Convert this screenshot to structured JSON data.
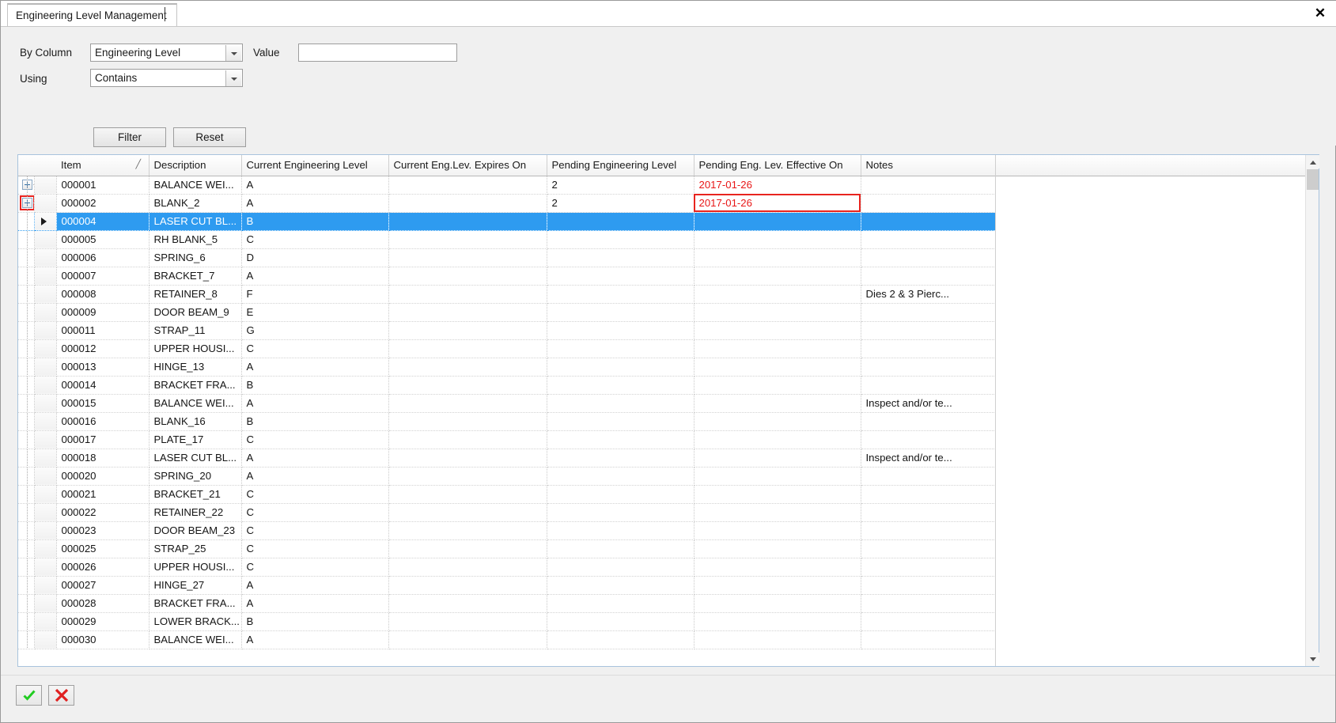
{
  "window": {
    "tab_title": "Engineering Level Management",
    "close_icon": "close-icon",
    "close_glyph": "✕"
  },
  "filter": {
    "by_column_label": "By Column",
    "by_column_value": "Engineering Level",
    "using_label": "Using",
    "using_value": "Contains",
    "value_label": "Value",
    "value_text": "",
    "value_placeholder": "",
    "filter_button": "Filter",
    "reset_button": "Reset"
  },
  "grid": {
    "columns": [
      {
        "key": "item",
        "label": "Item",
        "sorted": "asc",
        "sort_glyph": "╱"
      },
      {
        "key": "description",
        "label": "Description"
      },
      {
        "key": "current_level",
        "label": "Current Engineering Level"
      },
      {
        "key": "current_expires",
        "label": "Current Eng.Lev. Expires On"
      },
      {
        "key": "pending_level",
        "label": "Pending Engineering Level"
      },
      {
        "key": "pending_effective",
        "label": "Pending Eng. Lev. Effective On"
      },
      {
        "key": "notes",
        "label": "Notes"
      }
    ],
    "rows": [
      {
        "expander": true,
        "item": "000001",
        "description": "BALANCE  WEI...",
        "current_level": "A",
        "current_expires": "",
        "pending_level": "2",
        "pending_effective": "2017-01-26",
        "pending_effective_red": true,
        "notes": ""
      },
      {
        "expander": true,
        "expander_focused": true,
        "item": "000002",
        "description": "BLANK_2",
        "current_level": "A",
        "current_expires": "",
        "pending_level": "2",
        "pending_effective": "2017-01-26",
        "pending_effective_red": true,
        "pending_effective_focus": true,
        "notes": ""
      },
      {
        "selected": true,
        "item": "000004",
        "description": "LASER  CUT  BL...",
        "current_level": "B",
        "current_expires": "",
        "pending_level": "",
        "pending_effective": "",
        "notes": ""
      },
      {
        "item": "000005",
        "description": "RH BLANK_5",
        "current_level": "C",
        "current_expires": "",
        "pending_level": "",
        "pending_effective": "",
        "notes": ""
      },
      {
        "item": "000006",
        "description": "SPRING_6",
        "current_level": "D",
        "current_expires": "",
        "pending_level": "",
        "pending_effective": "",
        "notes": ""
      },
      {
        "item": "000007",
        "description": "BRACKET_7",
        "current_level": "A",
        "current_expires": "",
        "pending_level": "",
        "pending_effective": "",
        "notes": ""
      },
      {
        "item": "000008",
        "description": "RETAINER_8",
        "current_level": "F",
        "current_expires": "",
        "pending_level": "",
        "pending_effective": "",
        "notes": "Dies 2 & 3 Pierc..."
      },
      {
        "item": "000009",
        "description": "DOOR BEAM_9",
        "current_level": "E",
        "current_expires": "",
        "pending_level": "",
        "pending_effective": "",
        "notes": ""
      },
      {
        "item": "000011",
        "description": "STRAP_11",
        "current_level": "G",
        "current_expires": "",
        "pending_level": "",
        "pending_effective": "",
        "notes": ""
      },
      {
        "item": "000012",
        "description": "UPPER  HOUSI...",
        "current_level": "C",
        "current_expires": "",
        "pending_level": "",
        "pending_effective": "",
        "notes": ""
      },
      {
        "item": "000013",
        "description": "HINGE_13",
        "current_level": "A",
        "current_expires": "",
        "pending_level": "",
        "pending_effective": "",
        "notes": ""
      },
      {
        "item": "000014",
        "description": "BRACKET  FRA...",
        "current_level": "B",
        "current_expires": "",
        "pending_level": "",
        "pending_effective": "",
        "notes": ""
      },
      {
        "item": "000015",
        "description": "BALANCE  WEI...",
        "current_level": "A",
        "current_expires": "",
        "pending_level": "",
        "pending_effective": "",
        "notes": "Inspect and/or te..."
      },
      {
        "item": "000016",
        "description": "BLANK_16",
        "current_level": "B",
        "current_expires": "",
        "pending_level": "",
        "pending_effective": "",
        "notes": ""
      },
      {
        "item": "000017",
        "description": "PLATE_17",
        "current_level": "C",
        "current_expires": "",
        "pending_level": "",
        "pending_effective": "",
        "notes": ""
      },
      {
        "item": "000018",
        "description": "LASER  CUT  BL...",
        "current_level": "A",
        "current_expires": "",
        "pending_level": "",
        "pending_effective": "",
        "notes": "Inspect and/or te..."
      },
      {
        "item": "000020",
        "description": "SPRING_20",
        "current_level": "A",
        "current_expires": "",
        "pending_level": "",
        "pending_effective": "",
        "notes": ""
      },
      {
        "item": "000021",
        "description": "BRACKET_21",
        "current_level": "C",
        "current_expires": "",
        "pending_level": "",
        "pending_effective": "",
        "notes": ""
      },
      {
        "item": "000022",
        "description": "RETAINER_22",
        "current_level": "C",
        "current_expires": "",
        "pending_level": "",
        "pending_effective": "",
        "notes": ""
      },
      {
        "item": "000023",
        "description": "DOOR BEAM_23",
        "current_level": "C",
        "current_expires": "",
        "pending_level": "",
        "pending_effective": "",
        "notes": ""
      },
      {
        "item": "000025",
        "description": "STRAP_25",
        "current_level": "C",
        "current_expires": "",
        "pending_level": "",
        "pending_effective": "",
        "notes": ""
      },
      {
        "item": "000026",
        "description": "UPPER  HOUSI...",
        "current_level": "C",
        "current_expires": "",
        "pending_level": "",
        "pending_effective": "",
        "notes": ""
      },
      {
        "item": "000027",
        "description": "HINGE_27",
        "current_level": "A",
        "current_expires": "",
        "pending_level": "",
        "pending_effective": "",
        "notes": ""
      },
      {
        "item": "000028",
        "description": "BRACKET  FRA...",
        "current_level": "A",
        "current_expires": "",
        "pending_level": "",
        "pending_effective": "",
        "notes": ""
      },
      {
        "item": "000029",
        "description": "LOWER  BRACK...",
        "current_level": "B",
        "current_expires": "",
        "pending_level": "",
        "pending_effective": "",
        "notes": ""
      },
      {
        "item": "000030",
        "description": "BALANCE  WEI...",
        "current_level": "A",
        "current_expires": "",
        "pending_level": "",
        "pending_effective": "",
        "notes": ""
      }
    ]
  },
  "toolbar": {
    "ok_icon": "check-icon",
    "cancel_icon": "cross-icon"
  },
  "colors": {
    "accent_selection": "#2e9bf0",
    "alert_red": "#e81717",
    "focus_red": "#e8241f",
    "check_green": "#22cc22",
    "panel_bg": "#f0f0f0"
  }
}
